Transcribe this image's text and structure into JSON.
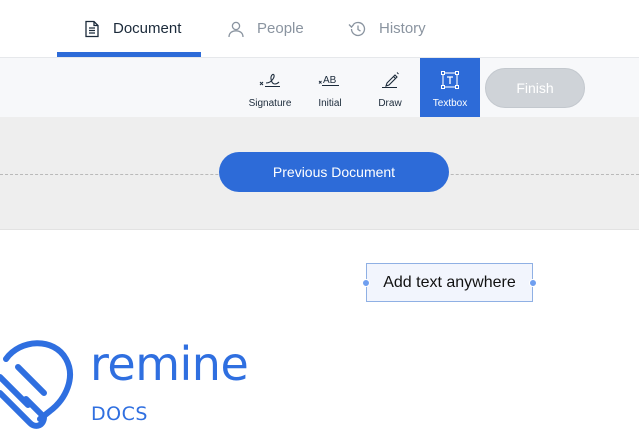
{
  "tabs": [
    {
      "label": "Document",
      "icon": "document-icon",
      "active": true
    },
    {
      "label": "People",
      "icon": "person-icon",
      "active": false
    },
    {
      "label": "History",
      "icon": "history-icon",
      "active": false
    }
  ],
  "toolbar": {
    "tools": [
      {
        "label": "Signature",
        "icon": "signature-icon",
        "active": false
      },
      {
        "label": "Initial",
        "icon": "initial-icon",
        "active": false
      },
      {
        "label": "Draw",
        "icon": "draw-pen-icon",
        "active": false
      },
      {
        "label": "Textbox",
        "icon": "textbox-icon",
        "active": true
      }
    ],
    "finish_label": "Finish"
  },
  "band": {
    "previous_document_label": "Previous Document"
  },
  "document": {
    "textbox_text": "Add text anywhere",
    "logo": {
      "word": "remine",
      "sub": "DOCS"
    }
  },
  "colors": {
    "accent": "#2d6bd8",
    "finish_disabled": "#cfd3d8",
    "band": "#eeeeee",
    "logo": "#2f6fe0"
  }
}
